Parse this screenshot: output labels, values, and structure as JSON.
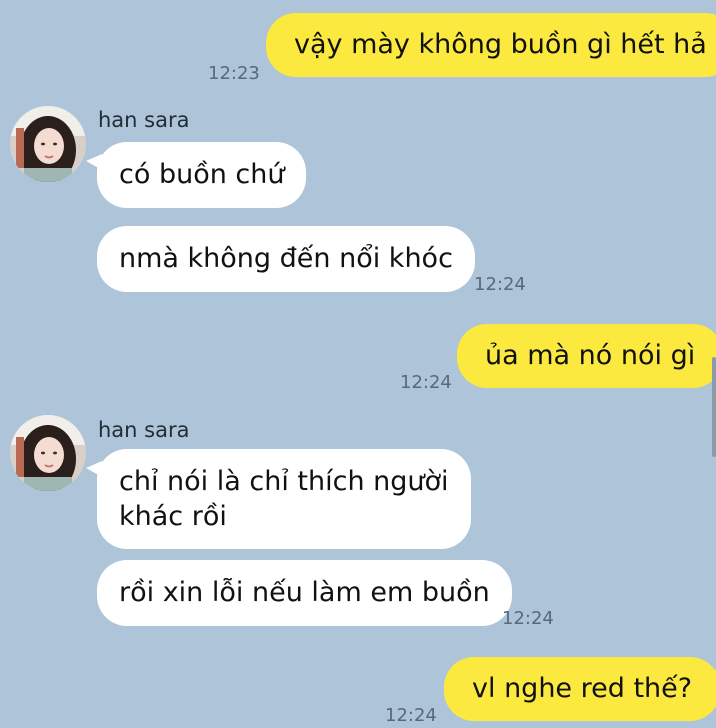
{
  "contact": {
    "name": "han sara"
  },
  "messages": [
    {
      "from": "me",
      "text": "vậy mày không buồn gì hết hả",
      "time": "12:23"
    },
    {
      "from": "han sara",
      "text": "có buồn chứ"
    },
    {
      "from": "han sara",
      "text": "nmà không đến nổi khóc",
      "time": "12:24"
    },
    {
      "from": "me",
      "text": "ủa mà nó nói gì",
      "time": "12:24"
    },
    {
      "from": "han sara",
      "lines": [
        "chỉ nói là chỉ thích người",
        "khác rồi"
      ]
    },
    {
      "from": "han sara",
      "text": "rồi xin lỗi nếu làm em buồn",
      "time": "12:24"
    },
    {
      "from": "me",
      "text": "vl nghe red thế?",
      "time": "12:24"
    }
  ],
  "colors": {
    "background": "#adc4d9",
    "outgoing_bubble": "#fce940",
    "incoming_bubble": "#ffffff",
    "timestamp": "#57697a"
  },
  "icons": {
    "avatar": "contact-avatar-photo"
  }
}
